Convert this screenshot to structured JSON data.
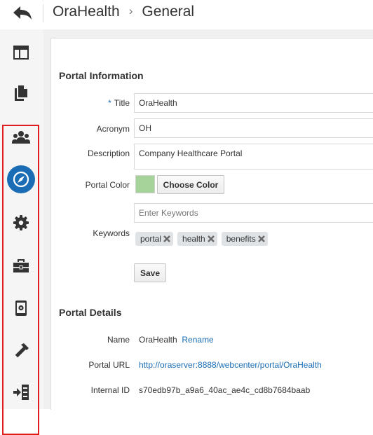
{
  "header": {
    "crumb_root": "OraHealth",
    "crumb_separator": "›",
    "crumb_current": "General"
  },
  "sidebar": {
    "items": [
      {
        "icon": "layout-icon"
      },
      {
        "icon": "pages-icon"
      },
      {
        "icon": "members-icon"
      },
      {
        "icon": "compass-icon",
        "active": true
      },
      {
        "icon": "gear-icon"
      },
      {
        "icon": "toolbox-icon"
      },
      {
        "icon": "device-settings-icon"
      },
      {
        "icon": "hammer-icon"
      },
      {
        "icon": "exit-icon"
      }
    ],
    "accent_color": "#1a6db4",
    "highlight_border_color": "#e01c1c"
  },
  "portal_info": {
    "section_title": "Portal Information",
    "title_label": "Title",
    "title_required_marker": "*",
    "title_value": "OraHealth",
    "acronym_label": "Acronym",
    "acronym_value": "OH",
    "description_label": "Description",
    "description_value": "Company Healthcare Portal",
    "color_label": "Portal Color",
    "color_value": "#a5d39a",
    "choose_color_label": "Choose Color",
    "keywords_label": "Keywords",
    "keywords_placeholder": "Enter Keywords",
    "keywords": [
      "portal",
      "health",
      "benefits"
    ],
    "save_label": "Save"
  },
  "portal_details": {
    "section_title": "Portal Details",
    "name_label": "Name",
    "name_value": "OraHealth",
    "rename_label": "Rename",
    "url_label": "Portal URL",
    "url_value": "http://oraserver:8888/webcenter/portal/OraHealth",
    "internal_id_label": "Internal ID",
    "internal_id_value": "s70edb97b_a9a6_40ac_ae4c_cd8b7684baab"
  }
}
